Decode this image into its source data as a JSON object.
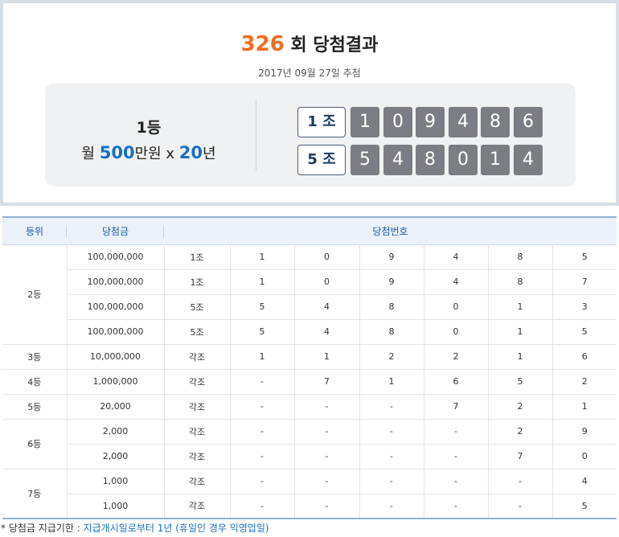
{
  "header": {
    "round_number": "326",
    "round_suffix": "회 당첨결과",
    "draw_date": "2017년 09월 27일 추첨"
  },
  "first_prize": {
    "rank_label": "1등",
    "prize_prefix": "월 ",
    "prize_amount": "500",
    "prize_unit": "만원 x ",
    "prize_years": "20",
    "prize_years_unit": "년",
    "rows": [
      {
        "group": "1 조",
        "numbers": [
          "1",
          "0",
          "9",
          "4",
          "8",
          "6"
        ]
      },
      {
        "group": "5 조",
        "numbers": [
          "5",
          "4",
          "8",
          "0",
          "1",
          "4"
        ]
      }
    ]
  },
  "table": {
    "headers": {
      "rank": "등위",
      "amount": "당첨금",
      "numbers": "당첨번호"
    },
    "rows": [
      {
        "rank": "2등",
        "amount": "100,000,000",
        "group": "1조",
        "d": [
          "1",
          "0",
          "9",
          "4",
          "8",
          "5"
        ]
      },
      {
        "rank": "",
        "amount": "100,000,000",
        "group": "1조",
        "d": [
          "1",
          "0",
          "9",
          "4",
          "8",
          "7"
        ]
      },
      {
        "rank": "",
        "amount": "100,000,000",
        "group": "5조",
        "d": [
          "5",
          "4",
          "8",
          "0",
          "1",
          "3"
        ]
      },
      {
        "rank": "",
        "amount": "100,000,000",
        "group": "5조",
        "d": [
          "5",
          "4",
          "8",
          "0",
          "1",
          "5"
        ]
      },
      {
        "rank": "3등",
        "amount": "10,000,000",
        "group": "각조",
        "d": [
          "1",
          "1",
          "2",
          "2",
          "1",
          "6"
        ]
      },
      {
        "rank": "4등",
        "amount": "1,000,000",
        "group": "각조",
        "d": [
          "-",
          "7",
          "1",
          "6",
          "5",
          "2"
        ]
      },
      {
        "rank": "5등",
        "amount": "20,000",
        "group": "각조",
        "d": [
          "-",
          "-",
          "-",
          "7",
          "2",
          "1"
        ]
      },
      {
        "rank": "6등",
        "amount": "2,000",
        "group": "각조",
        "d": [
          "-",
          "-",
          "-",
          "-",
          "2",
          "9"
        ]
      },
      {
        "rank": "",
        "amount": "2,000",
        "group": "각조",
        "d": [
          "-",
          "-",
          "-",
          "-",
          "7",
          "0"
        ]
      },
      {
        "rank": "7등",
        "amount": "1,000",
        "group": "각조",
        "d": [
          "-",
          "-",
          "-",
          "-",
          "-",
          "4"
        ]
      },
      {
        "rank": "",
        "amount": "1,000",
        "group": "각조",
        "d": [
          "-",
          "-",
          "-",
          "-",
          "-",
          "5"
        ]
      }
    ]
  },
  "note": {
    "label": "* 당첨금 지급기한 : ",
    "text": "지급개시일로부터 1년 (휴일인 경우 익영업일)"
  }
}
